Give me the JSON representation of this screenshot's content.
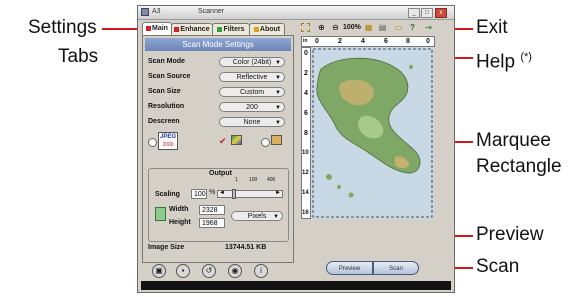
{
  "callouts": {
    "settings": "Settings",
    "tabs": "Tabs",
    "exit": "Exit",
    "help": "Help",
    "help_mark": "(*)",
    "marquee_1": "Marquee",
    "marquee_2": "Rectangle",
    "preview": "Preview",
    "scan": "Scan",
    "line_color": "#d0181b"
  },
  "window": {
    "title_app": "A3",
    "title": "Scanner",
    "btn_min": "_",
    "btn_max": "□",
    "btn_close": "x"
  },
  "tabs": [
    {
      "label": "Main",
      "color": "#d4202a"
    },
    {
      "label": "Enhance",
      "color": "#d4202a"
    },
    {
      "label": "Filters",
      "color": "#33a23a"
    },
    {
      "label": "About",
      "color": "#e0a020"
    }
  ],
  "panel": {
    "title": "Scan Mode Settings",
    "rows": [
      {
        "label": "Scan Mode",
        "value": "Color (24bit)"
      },
      {
        "label": "Scan Source",
        "value": "Reflective"
      },
      {
        "label": "Scan Size",
        "value": "Custom"
      },
      {
        "label": "Resolution",
        "value": "200"
      },
      {
        "label": "Descreen",
        "value": "None"
      }
    ],
    "jpeg_badge": "JPEG",
    "jpeg_sub": "2000",
    "output": {
      "title": "Output",
      "scaling_label": "Scaling",
      "scaling_value": "100",
      "scaling_unit": "%",
      "scale_marks": [
        "1",
        "100",
        "400"
      ],
      "width_label": "Width",
      "width_value": "2328",
      "height_label": "Height",
      "height_value": "1968",
      "units": "Pixels"
    },
    "image_size_label": "Image Size",
    "image_size_value": "13744.51 KB"
  },
  "toolbar": {
    "zoom_level": "100%"
  },
  "ruler": {
    "corner": "in",
    "h_ticks": [
      "0",
      "2",
      "4",
      "6",
      "8",
      "0"
    ],
    "v_ticks": [
      "0",
      "2",
      "4",
      "6",
      "8",
      "10",
      "12",
      "14",
      "16"
    ]
  },
  "buttons": {
    "preview": "Preview",
    "scan": "Scan"
  }
}
